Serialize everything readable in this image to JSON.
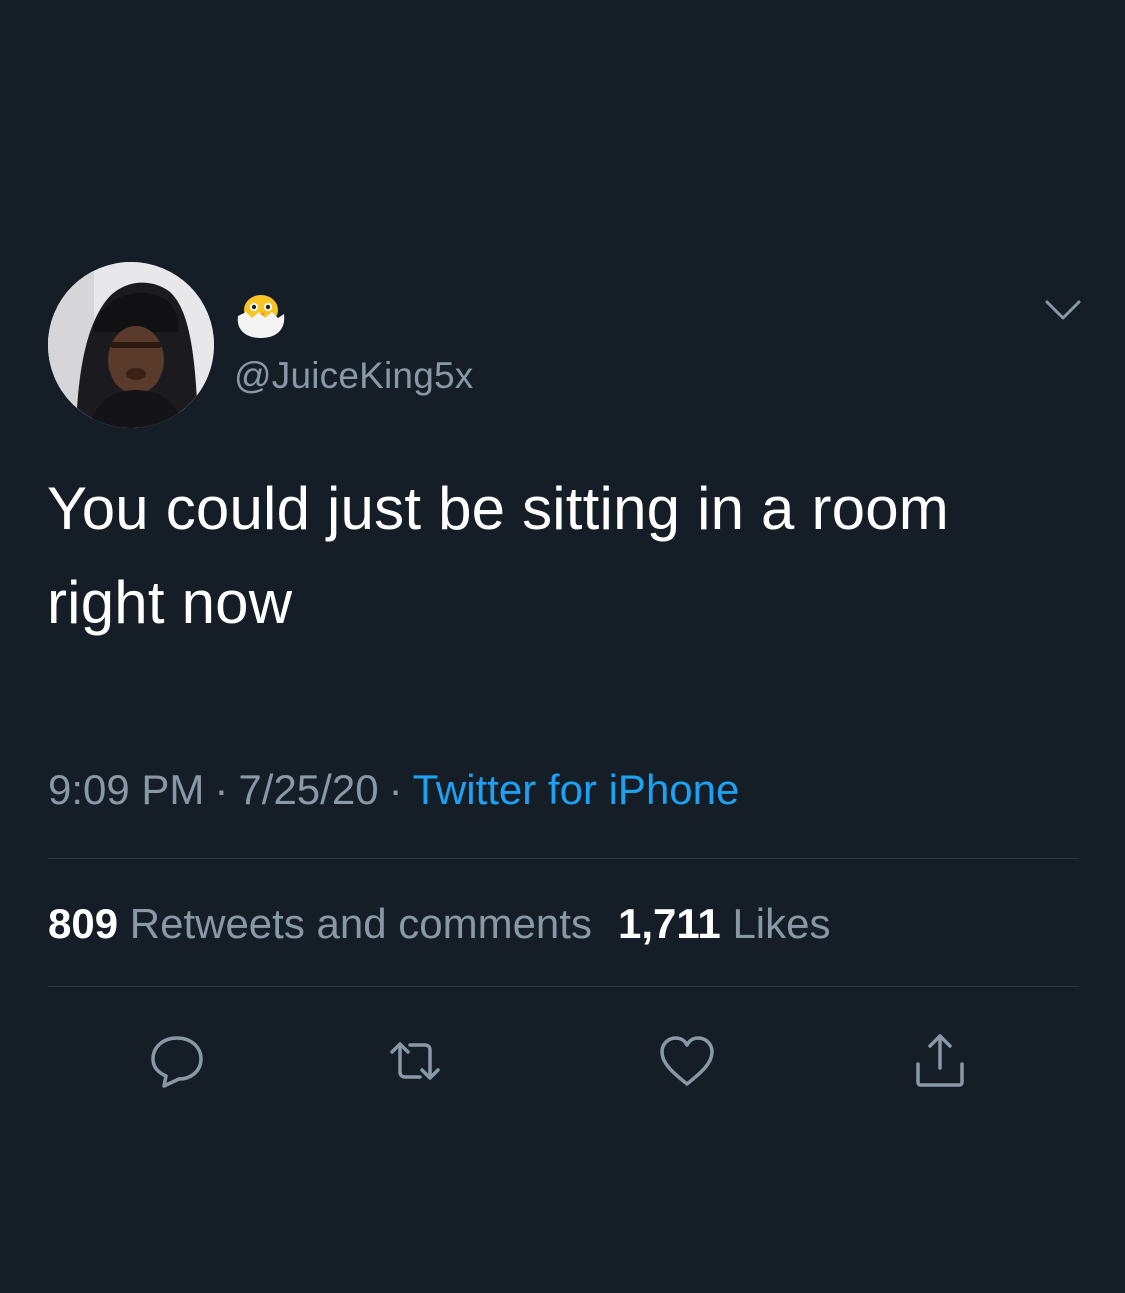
{
  "user": {
    "display_name_emoji": "🐣",
    "handle": "@JuiceKing5x"
  },
  "tweet": {
    "text_line1": "You could just be sitting in a room",
    "text_line2": "right now",
    "time": "9:09 PM",
    "date": "7/25/20",
    "source": "Twitter for iPhone",
    "separator": "·"
  },
  "stats": {
    "retweets_count": "809",
    "retweets_label": "Retweets and comments",
    "likes_count": "1,711",
    "likes_label": "Likes"
  },
  "icons": {
    "reply": "reply-icon",
    "retweet": "retweet-icon",
    "like": "heart-icon",
    "share": "share-icon",
    "menu": "chevron-down-icon"
  },
  "colors": {
    "background": "#151d26",
    "text": "#ffffff",
    "secondary": "#8899a6",
    "link": "#1da1f2",
    "divider": "#2b3640"
  }
}
